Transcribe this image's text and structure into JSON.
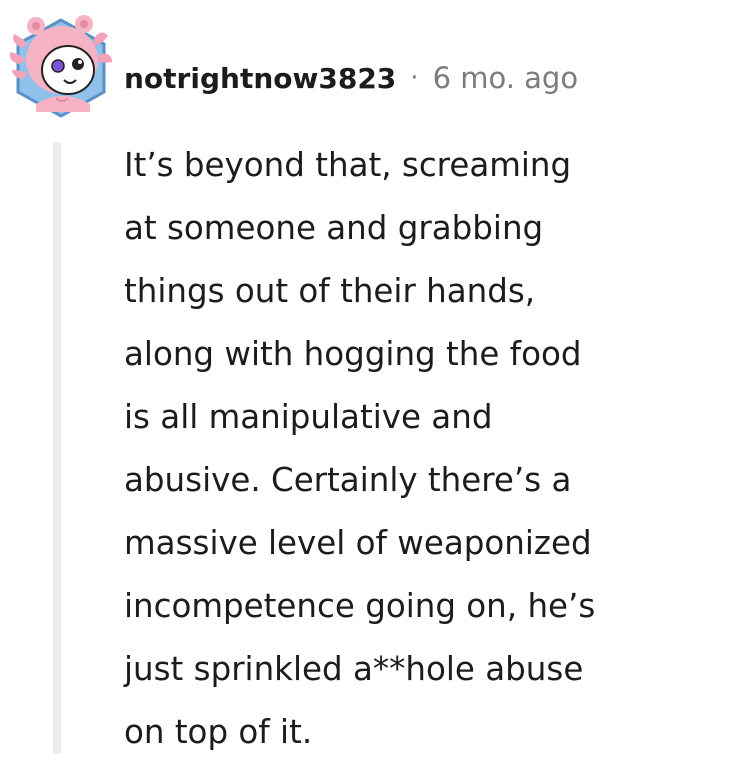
{
  "comment": {
    "author": "notrightnow3823",
    "separator": "·",
    "timestamp": "6 mo. ago",
    "body_lines": [
      "It’s beyond that, screaming",
      "at someone and grabbing",
      "things out of their hands,",
      "along with hogging the food",
      "is all manipulative and",
      "abusive. Certainly there’s a",
      "massive level of weaponized",
      "incompetence going on, he’s",
      "just sprinkled a**hole abuse",
      "on top of it."
    ],
    "avatar_icon": "axolotl-avatar-icon"
  },
  "colors": {
    "username": "#1c1c1c",
    "meta": "#7c7c7c",
    "thread_line": "#ececec",
    "avatar_pink": "#f3a6b8",
    "avatar_bg": "#7fb3e0"
  }
}
